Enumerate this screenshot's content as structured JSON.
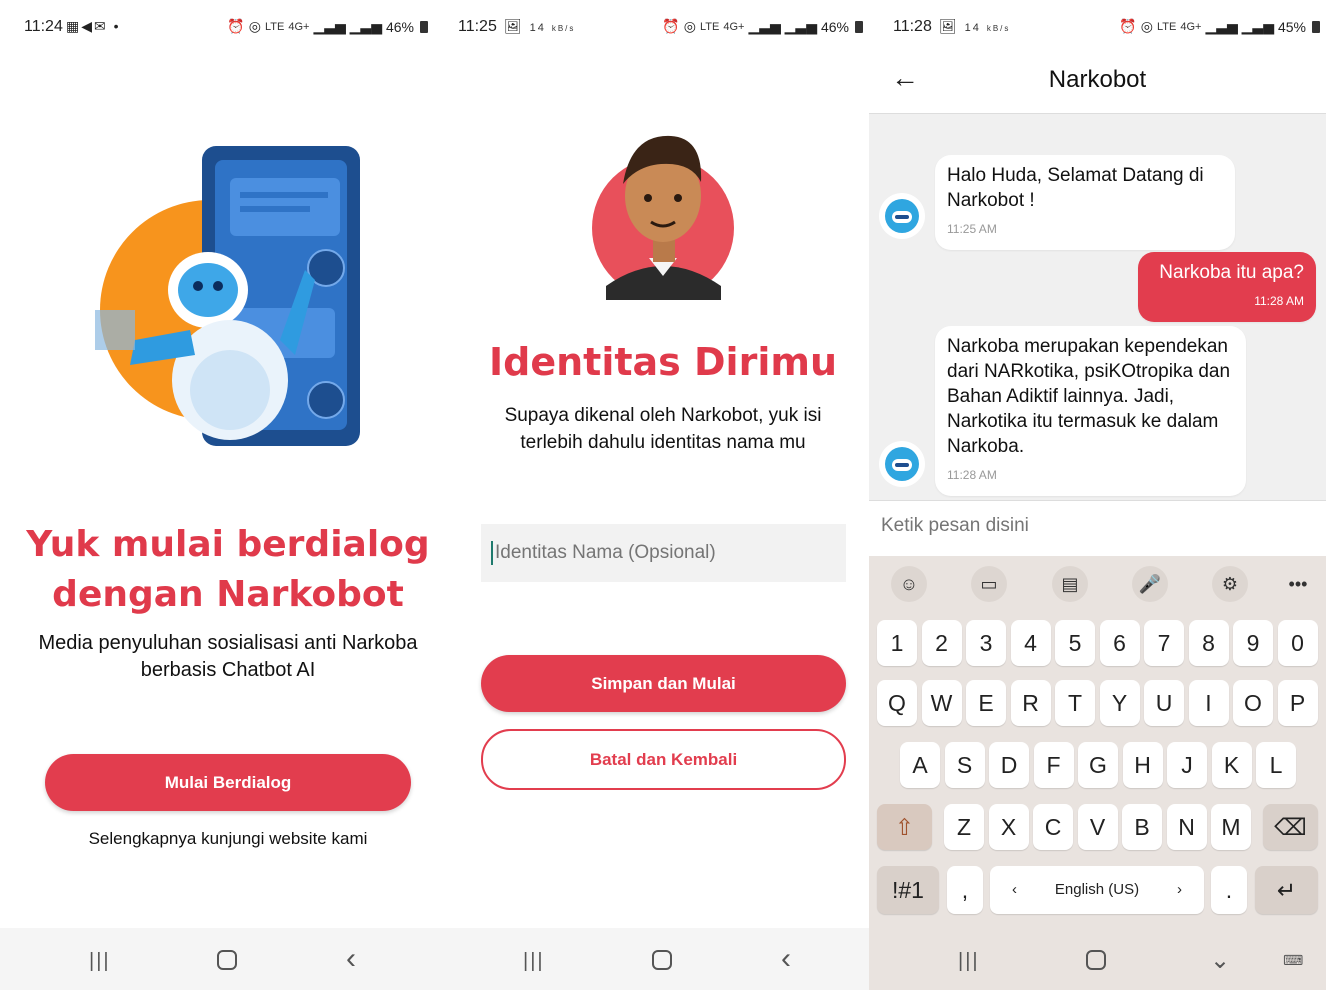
{
  "screen1": {
    "status": {
      "time": "11:24",
      "battery": "46%"
    },
    "title_line1": "Yuk mulai berdialog",
    "title_line2": "dengan Narkobot",
    "subtitle_line1": "Media penyuluhan sosialisasi anti Narkoba",
    "subtitle_line2": "berbasis Chatbot AI",
    "button": "Mulai Berdialog",
    "link": "Selengkapnya kunjungi website kami"
  },
  "screen2": {
    "status": {
      "time": "11:25",
      "battery": "46%",
      "speed": "14",
      "speed_unit": "kB/s"
    },
    "title": "Identitas Dirimu",
    "subtitle_line1": "Supaya dikenal oleh Narkobot, yuk isi",
    "subtitle_line2": "terlebih dahulu identitas nama mu",
    "input_placeholder": "Identitas Nama (Opsional)",
    "save_button": "Simpan dan Mulai",
    "cancel_button": "Batal dan Kembali"
  },
  "screen3": {
    "status": {
      "time": "11:28",
      "battery": "45%",
      "speed": "14",
      "speed_unit": "kB/s"
    },
    "title": "Narkobot",
    "messages": [
      {
        "from": "bot",
        "text": "Halo Huda, Selamat Datang di Narkobot !",
        "time": "11:25 AM"
      },
      {
        "from": "user",
        "text": "Narkoba itu apa?",
        "time": "11:28 AM"
      },
      {
        "from": "bot",
        "text": "Narkoba merupakan kependekan dari NARkotika, psiKOtropika dan Bahan Adiktif lainnya. Jadi, Narkotika itu termasuk ke dalam Narkoba.",
        "time": "11:28 AM"
      }
    ],
    "compose_placeholder": "Ketik pesan disini",
    "keyboard": {
      "numbers": [
        "1",
        "2",
        "3",
        "4",
        "5",
        "6",
        "7",
        "8",
        "9",
        "0"
      ],
      "row1": [
        "Q",
        "W",
        "E",
        "R",
        "T",
        "Y",
        "U",
        "I",
        "O",
        "P"
      ],
      "row2": [
        "A",
        "S",
        "D",
        "F",
        "G",
        "H",
        "J",
        "K",
        "L"
      ],
      "row3": [
        "Z",
        "X",
        "C",
        "V",
        "B",
        "N",
        "M"
      ],
      "symbols": "!#1",
      "comma": ",",
      "period": ".",
      "language": "English (US)"
    }
  },
  "colors": {
    "brand_red": "#e23d4e",
    "chat_bg": "#f0f0f0",
    "keyboard_bg": "#e9e3df"
  }
}
